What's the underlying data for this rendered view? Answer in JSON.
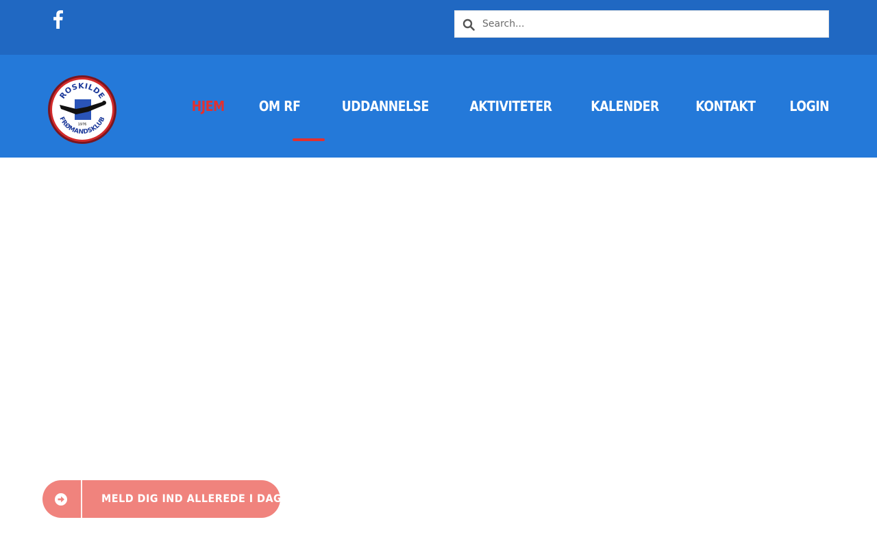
{
  "topbar": {
    "social": [
      {
        "name": "facebook-icon"
      }
    ],
    "search": {
      "placeholder": "Search..."
    }
  },
  "header": {
    "logo": {
      "top_text": "ROSKILDE",
      "bottom_text": "FRØMANDSKLUB",
      "year": "1976"
    },
    "nav": [
      {
        "label": "HJEM",
        "active": true
      },
      {
        "label": "OM RF",
        "active": false
      },
      {
        "label": "UDDANNELSE",
        "active": false
      },
      {
        "label": "AKTIVITETER",
        "active": false
      },
      {
        "label": "KALENDER",
        "active": false
      },
      {
        "label": "KONTAKT",
        "active": false
      },
      {
        "label": "LOGIN",
        "active": false
      }
    ]
  },
  "cta": {
    "label": "MELD DIG IND ALLEREDE I DAG",
    "icon": "arrow-circle-right-icon"
  },
  "colors": {
    "topbar_bg": "#2068c2",
    "header_bg": "#2479d9",
    "active_nav": "#e3302f",
    "cta_bg": "#f0837d"
  }
}
